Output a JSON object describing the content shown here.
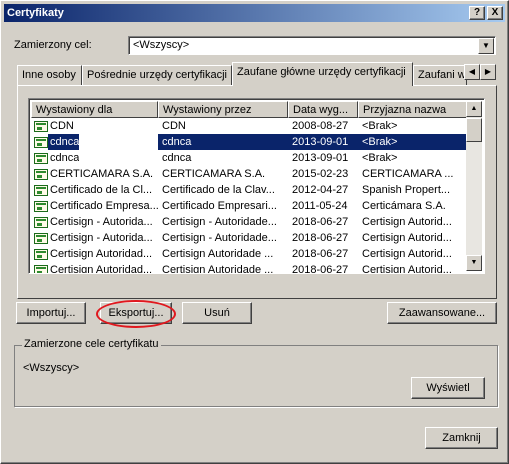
{
  "window": {
    "title": "Certyfikaty",
    "help_label": "?",
    "close_label": "X"
  },
  "purpose": {
    "label": "Zamierzony cel:",
    "value": "<Wszyscy>"
  },
  "tabs": [
    {
      "label": "Inne osoby"
    },
    {
      "label": "Pośrednie urzędy certyfikacji"
    },
    {
      "label": "Zaufane główne urzędy certyfikacji"
    },
    {
      "label": "Zaufani w"
    }
  ],
  "columns": [
    "Wystawiony dla",
    "Wystawiony przez",
    "Data wyg...",
    "Przyjazna nazwa"
  ],
  "rows": [
    {
      "issued_to": "CDN",
      "issued_by": "CDN",
      "expires": "2008-08-27",
      "friendly": "<Brak>"
    },
    {
      "issued_to": "cdnca",
      "issued_by": "cdnca",
      "expires": "2013-09-01",
      "friendly": "<Brak>"
    },
    {
      "issued_to": "cdnca",
      "issued_by": "cdnca",
      "expires": "2013-09-01",
      "friendly": "<Brak>"
    },
    {
      "issued_to": "CERTICAMARA S.A.",
      "issued_by": "CERTICAMARA S.A.",
      "expires": "2015-02-23",
      "friendly": "CERTICAMARA ..."
    },
    {
      "issued_to": "Certificado de la Cl...",
      "issued_by": "Certificado de la Clav...",
      "expires": "2012-04-27",
      "friendly": "Spanish Propert..."
    },
    {
      "issued_to": "Certificado Empresa...",
      "issued_by": "Certificado Empresari...",
      "expires": "2011-05-24",
      "friendly": "Certicámara S.A."
    },
    {
      "issued_to": "Certisign - Autorida...",
      "issued_by": "Certisign - Autoridade...",
      "expires": "2018-06-27",
      "friendly": "Certisign Autorid..."
    },
    {
      "issued_to": "Certisign - Autorida...",
      "issued_by": "Certisign - Autoridade...",
      "expires": "2018-06-27",
      "friendly": "Certisign Autorid..."
    },
    {
      "issued_to": "Certisign Autoridad...",
      "issued_by": "Certisign Autoridade ...",
      "expires": "2018-06-27",
      "friendly": "Certisign Autorid..."
    },
    {
      "issued_to": "Certisign Autoridad...",
      "issued_by": "Certisign Autoridade ...",
      "expires": "2018-06-27",
      "friendly": "Certisign Autorid..."
    }
  ],
  "selected_row": 1,
  "buttons": {
    "import": "Importuj...",
    "export": "Eksportuj...",
    "remove": "Usuń",
    "advanced": "Zaawansowane...",
    "view": "Wyświetl",
    "close": "Zamknij"
  },
  "purposes_group": {
    "legend": "Zamierzone cele certyfikatu",
    "value": "<Wszyscy>"
  },
  "colors": {
    "title_start": "#0a246a",
    "title_end": "#a6caf0",
    "selection": "#0a246a",
    "highlight_ellipse": "#e0181e"
  }
}
